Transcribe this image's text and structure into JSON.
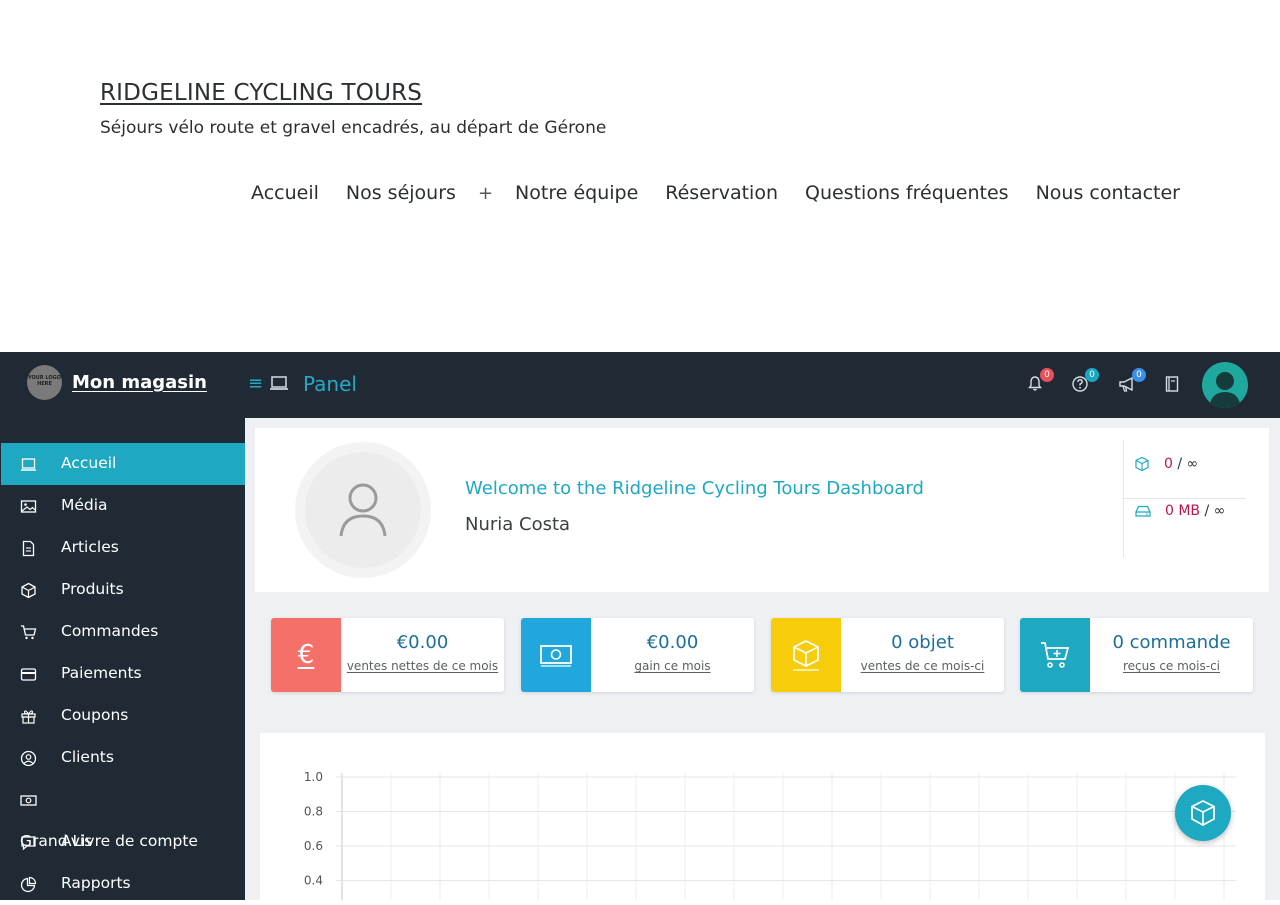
{
  "site": {
    "title": "RIDGELINE CYCLING TOURS",
    "tagline": "Séjours vélo route et gravel encadrés, au départ de Gérone",
    "nav": [
      "Accueil",
      "Nos séjours",
      "+",
      "Notre équipe",
      "Réservation",
      "Questions fréquentes",
      "Nous contacter"
    ]
  },
  "topbar": {
    "logo_text": "YOUR LOGO HERE",
    "brand": "Mon magasin",
    "menu_icon": "hamburger-icon",
    "panel_label": "Panel",
    "notifications": {
      "icon": "bell-icon",
      "count": "0"
    },
    "help": {
      "icon": "question-circle-icon",
      "count": "0"
    },
    "announcements": {
      "icon": "megaphone-icon",
      "count": "0"
    },
    "docs": {
      "icon": "book-icon"
    }
  },
  "sidebar": {
    "items": [
      {
        "label": "Accueil",
        "icon": "laptop-icon",
        "active": true
      },
      {
        "label": "Média",
        "icon": "images-icon"
      },
      {
        "label": "Articles",
        "icon": "file-icon"
      },
      {
        "label": "Produits",
        "icon": "box-icon"
      },
      {
        "label": "Commandes",
        "icon": "cart-icon"
      },
      {
        "label": "Paiements",
        "icon": "credit-card-icon"
      },
      {
        "label": "Coupons",
        "icon": "gift-icon"
      },
      {
        "label": "Clients",
        "icon": "user-circle-icon"
      },
      {
        "label": "",
        "icon": "money-bill-icon"
      },
      {
        "label": "Grand Livre de compte",
        "overlay_label": "Avis",
        "icon": "comment-icon"
      },
      {
        "label": "Rapports",
        "icon": "chart-pie-icon"
      }
    ]
  },
  "welcome": {
    "title": "Welcome to the Ridgeline Cycling Tours Dashboard",
    "user": "Nuria Costa",
    "quota_products": {
      "value": "0",
      "limit": "∞"
    },
    "quota_storage": {
      "value": "0 MB",
      "limit": "∞"
    }
  },
  "stats": [
    {
      "value": "€0.00",
      "label": "ventes nettes de ce mois",
      "icon": "euro-icon",
      "color": "#f6706a"
    },
    {
      "value": "€0.00",
      "label": "gain ce mois",
      "icon": "money-bill-icon",
      "color": "#22a7dc"
    },
    {
      "value": "0 objet",
      "label": "ventes de ce mois-ci",
      "icon": "box-icon",
      "color": "#f7cc0a"
    },
    {
      "value": "0 commande",
      "label": "reçus ce mois-ci",
      "icon": "cart-plus-icon",
      "color": "#1ea8c1"
    }
  ],
  "chart_data": {
    "type": "line",
    "title": "",
    "xlabel": "",
    "ylabel": "",
    "yticks": [
      "1.0",
      "0.8",
      "0.6",
      "0.4"
    ],
    "ylim": [
      0.4,
      1.0
    ],
    "grid": true,
    "series": []
  },
  "fab": {
    "icon": "box-icon"
  },
  "colors": {
    "dark": "#1f2a35",
    "accent": "#1ea8c1",
    "quota": "#c0134b"
  }
}
